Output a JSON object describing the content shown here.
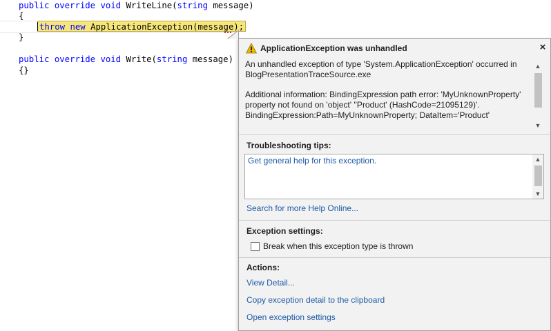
{
  "editor": {
    "lines": {
      "l1": {
        "kw1": "public",
        "kw2": "override",
        "kw3": "void",
        "name": "WriteLine(",
        "type": "string",
        "rest": "message)"
      },
      "l2": "{",
      "l3": {
        "kw1": "throw",
        "kw2": "new",
        "rest": "ApplicationException(message);"
      },
      "l4": "}",
      "l5": {
        "kw1": "public",
        "kw2": "override",
        "kw3": "void",
        "name": "Write(",
        "type": "string",
        "rest": "message)"
      },
      "l6": "{}"
    }
  },
  "popup": {
    "title": "ApplicationException was unhandled",
    "close_glyph": "×",
    "details": {
      "line1": "An unhandled exception of type 'System.ApplicationException' occurred in BlogPresentationTraceSource.exe",
      "line2": "Additional information: BindingExpression path error: 'MyUnknownProperty' property not found on 'object' ''Product' (HashCode=21095129)'. BindingExpression:Path=MyUnknownProperty; DataItem='Product'"
    },
    "troubleshooting": {
      "heading": "Troubleshooting tips:",
      "tip_link": "Get general help for this exception."
    },
    "search_link": "Search for more Help Online...",
    "exception_settings": {
      "heading": "Exception settings:",
      "checkbox_label": "Break when this exception type is thrown",
      "checked": false
    },
    "actions": {
      "heading": "Actions:",
      "items": [
        "View Detail...",
        "Copy exception detail to the clipboard",
        "Open exception settings"
      ]
    }
  },
  "colors": {
    "keyword": "#0000ff",
    "highlight": "#f7e77a",
    "link": "#1e5aa6",
    "warning": "#e8b800"
  },
  "icons": {
    "warning": "warning-icon",
    "close": "close-icon",
    "scroll_up": "chevron-up-icon",
    "scroll_down": "chevron-down-icon"
  }
}
